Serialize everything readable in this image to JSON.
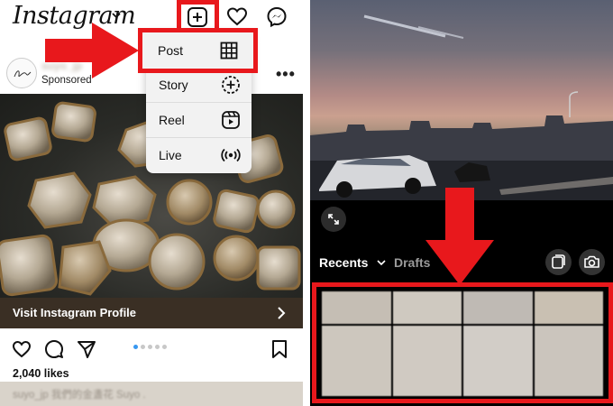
{
  "left_app": {
    "logo_text": "Instagram",
    "post_card": {
      "account_name": "suyo_jp",
      "sponsored_label": "Sponsored",
      "cta_label": "Visit Instagram Profile",
      "likes_text": "2,040 likes",
      "caption_text": "suyo_jp 我們的金盞花 Suyo ."
    },
    "create_menu": {
      "items": [
        {
          "label": "Post",
          "icon": "grid-icon"
        },
        {
          "label": "Story",
          "icon": "story-plus-icon"
        },
        {
          "label": "Reel",
          "icon": "reel-icon"
        },
        {
          "label": "Live",
          "icon": "live-broadcast-icon"
        }
      ]
    },
    "carousel": {
      "total_dots": 5,
      "active_index": 0
    }
  },
  "right_app": {
    "tabs": {
      "recents_label": "Recents",
      "drafts_label": "Drafts"
    }
  },
  "colors": {
    "highlight_red": "#e8181c",
    "carousel_active": "#3897f0"
  }
}
